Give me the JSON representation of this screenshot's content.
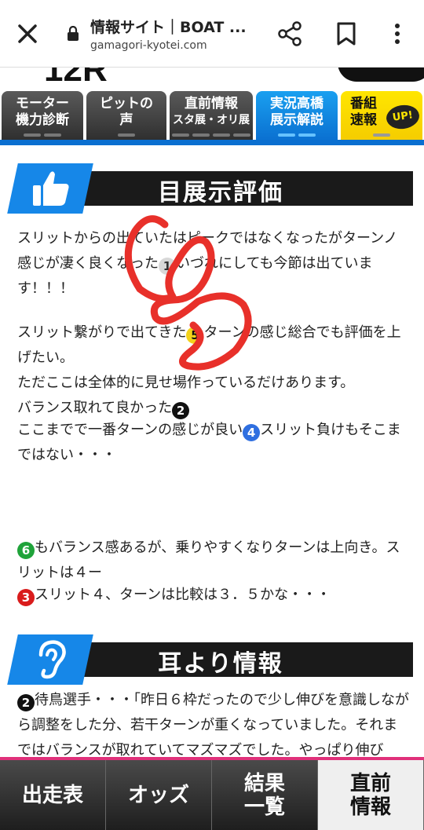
{
  "browser": {
    "title": "情報サイト｜BOAT ...",
    "url": "gamagori-kyotei.com"
  },
  "top_strip": {
    "fragment": "12R"
  },
  "tabs": [
    {
      "line1": "モーター",
      "line2": "機力診断"
    },
    {
      "line1": "ピットの",
      "line2": "声"
    },
    {
      "line1": "直前情報",
      "line2": "スタ展・オリ展"
    },
    {
      "line1": "実況高橋",
      "line2": "展示解説"
    },
    {
      "line1": "番組",
      "line2": "速報",
      "badge": "UP!"
    }
  ],
  "section1": {
    "title": "目展示評価",
    "icon": "thumbs-up-icon",
    "para1": "スリットからの出ていたはピークではなくなったがターンノ感じが凄く良くなった",
    "para1_num": "1",
    "para1_b": "いづれにしても今節は出ています！！！",
    "para2": "スリット繋がりで出てきた",
    "para2_num": "5",
    "para2_b": "ターンの感じ総合でも評価を上げたい。",
    "para3": "ただここは全体的に見せ場作っているだけあります。",
    "para4": "バランス取れて良かった",
    "para4_num": "2",
    "para5": "ここまでで一番ターンの感じが良い",
    "para5_num": "4",
    "para5_b": "スリット負けもそこまではない・・・",
    "para6_num": "6",
    "para6": "もバランス感あるが、乗りやすくなりターンは上向き。スリットは４ー",
    "para7_num": "3",
    "para7": "スリット４、ターンは比較は３．５かな・・・"
  },
  "section2": {
    "title": "耳より情報",
    "icon": "ear-icon",
    "para1_num": "2",
    "para1": "待鳥選手・・・「昨日６枠だったので少し伸びを意識しながら調整をした分、若干ターンが重くなっていました。それまではバランスが取れていてマズマズでした。やっぱり伸び"
  },
  "bottom_nav": [
    {
      "label": "出走表"
    },
    {
      "label": "オッズ"
    },
    {
      "label": "結果\n一覧"
    },
    {
      "label": "直前\n情報"
    }
  ],
  "colors": {
    "accent_blue": "#0a6fd0",
    "section_blue": "#1687e8",
    "pink": "#e0307a",
    "scribble_red": "#e8302a"
  }
}
